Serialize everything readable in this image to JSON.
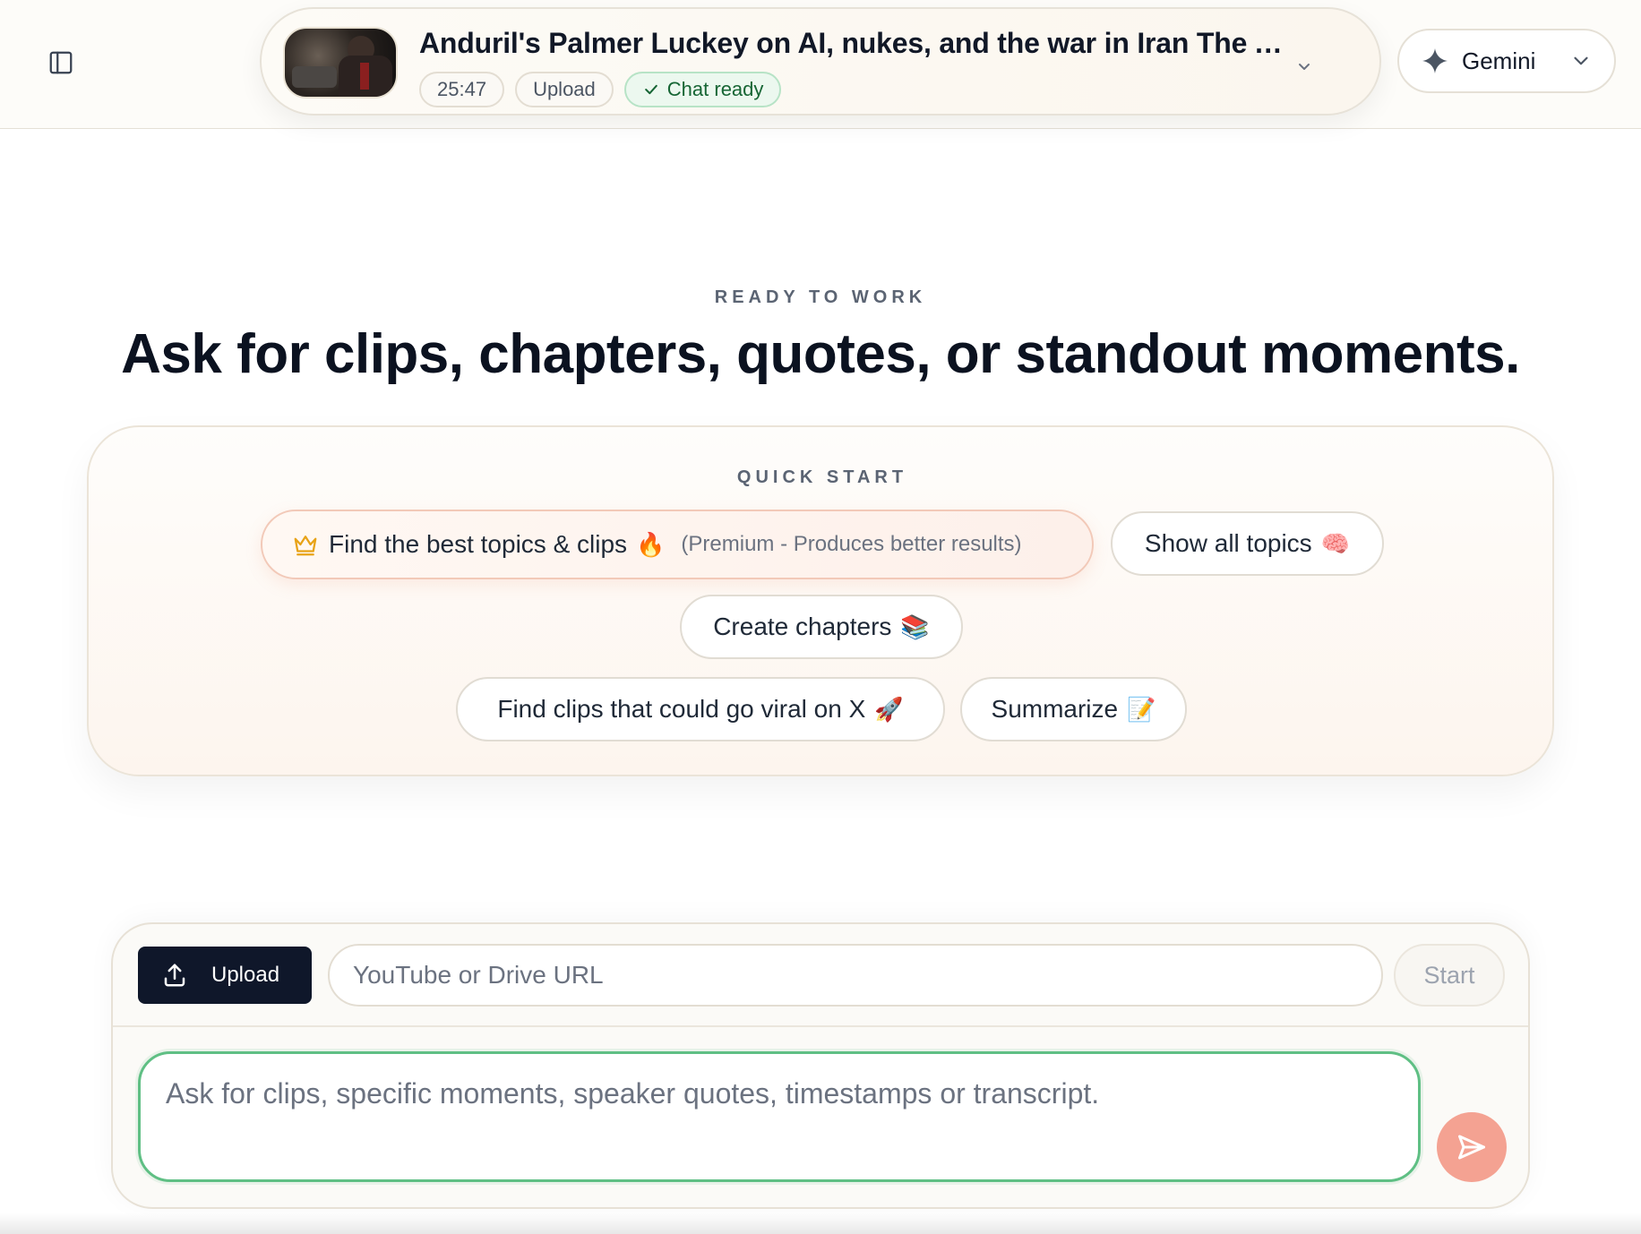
{
  "header": {
    "video": {
      "title": "Anduril's Palmer Luckey on AI, nukes, and the war in Iran The A...",
      "duration": "25:47",
      "source": "Upload",
      "status": "Chat ready",
      "thumbnail_icon": "video-thumbnail"
    },
    "model": {
      "label": "Gemini",
      "icon": "sparkle-icon"
    }
  },
  "hero": {
    "eyebrow": "READY TO WORK",
    "title": "Ask for clips, chapters, quotes, or standout moments."
  },
  "quick_start": {
    "eyebrow": "QUICK START",
    "chips": {
      "best_topics": {
        "label": "Find the best topics & clips",
        "emoji": "🔥",
        "note": "(Premium - Produces better results)",
        "icon": "crown-icon"
      },
      "all_topics": {
        "label": "Show all topics",
        "emoji": "🧠"
      },
      "chapters": {
        "label": "Create chapters",
        "emoji": "📚"
      },
      "viral": {
        "label": "Find clips that could go viral on X",
        "emoji": "🚀"
      },
      "summarize": {
        "label": "Summarize",
        "emoji": "📝"
      }
    }
  },
  "composer": {
    "upload_label": "Upload",
    "url_placeholder": "YouTube or Drive URL",
    "start_label": "Start",
    "prompt_placeholder": "Ask for clips, specific moments, speaker quotes, timestamps or transcript."
  },
  "colors": {
    "accent_green": "#5fbf84",
    "send_button": "#f4a292",
    "upload_button": "#0f172a"
  }
}
